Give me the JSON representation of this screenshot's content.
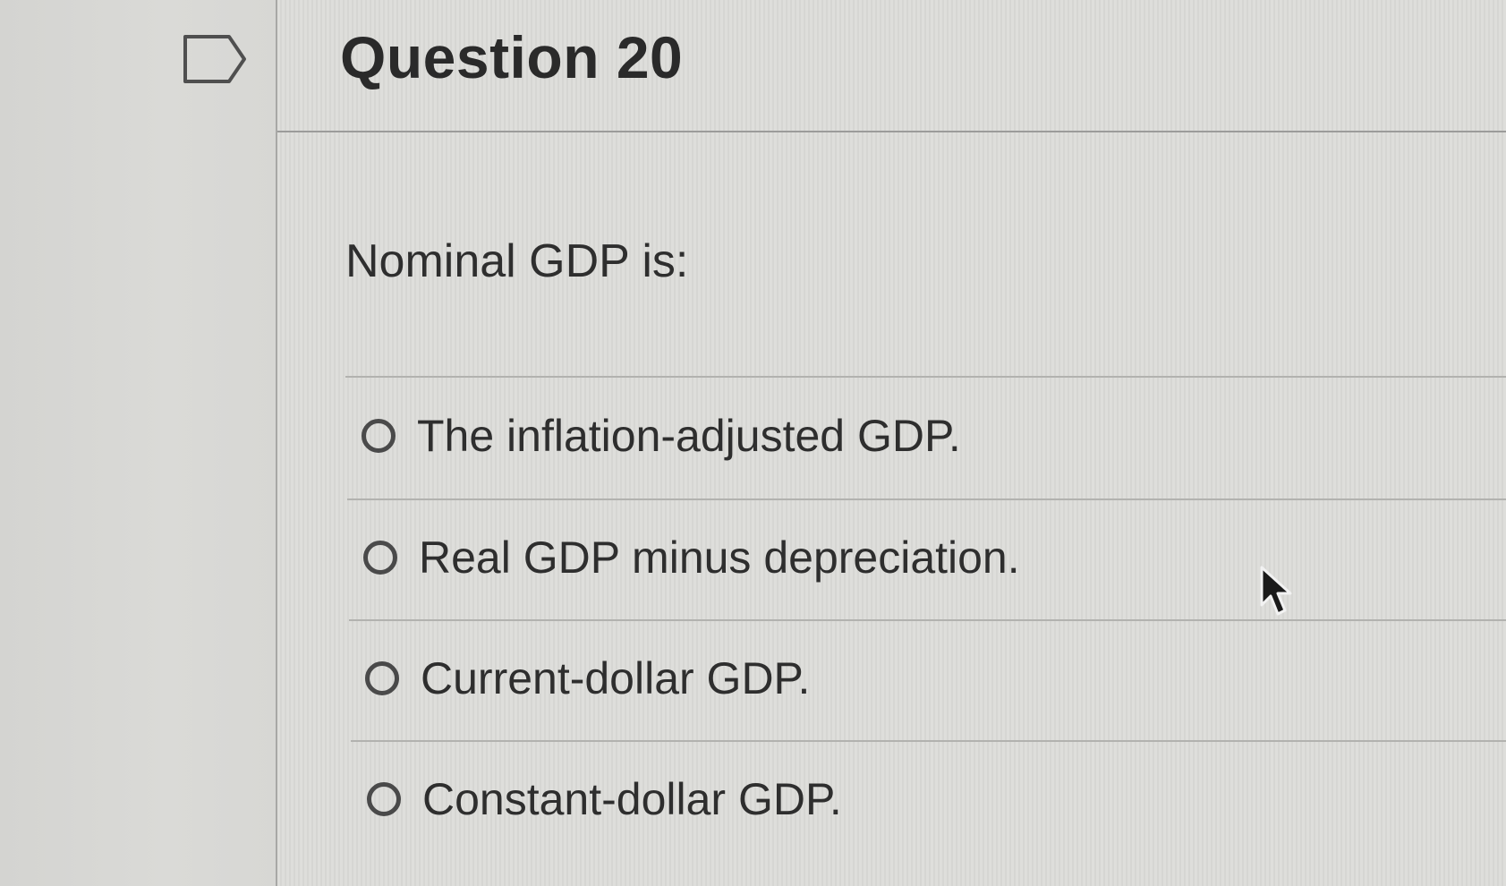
{
  "question": {
    "title": "Question 20",
    "prompt": "Nominal GDP is:",
    "options": [
      {
        "label": "The inflation-adjusted GDP.",
        "selected": false
      },
      {
        "label": "Real GDP minus depreciation.",
        "selected": false
      },
      {
        "label": "Current-dollar GDP.",
        "selected": false
      },
      {
        "label": "Constant-dollar GDP.",
        "selected": false
      }
    ]
  },
  "icons": {
    "flag": "flag-question-icon",
    "cursor": "mouse-pointer-icon"
  },
  "colors": {
    "text": "#2e2e2e",
    "radio_border": "#4a4a4a",
    "rule": "#b2b2af"
  }
}
